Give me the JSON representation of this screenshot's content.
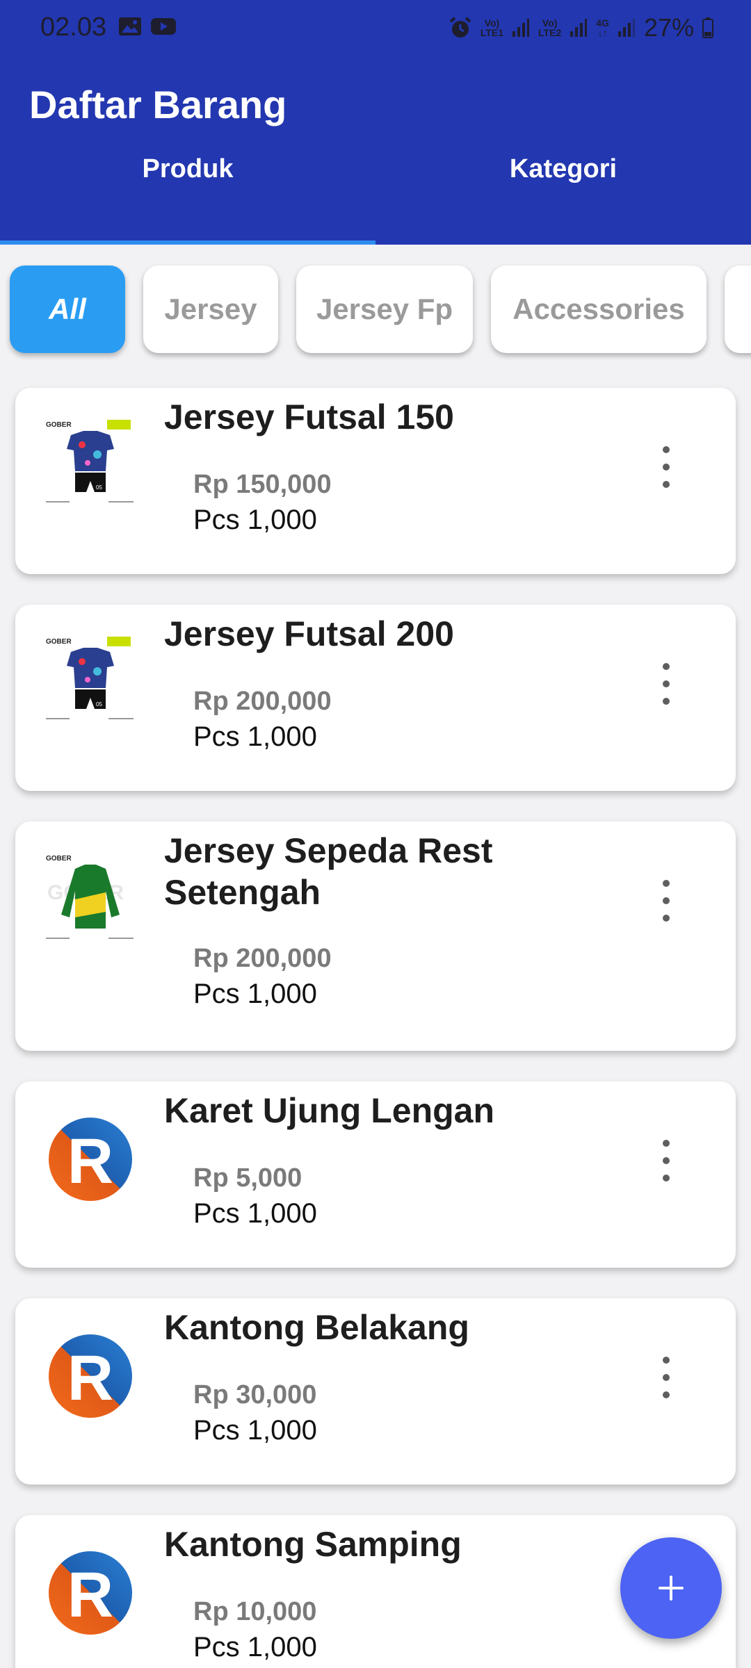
{
  "status_bar": {
    "time": "02.03",
    "sim1": "LTE1",
    "sim2": "LTE2",
    "network": "4G",
    "battery": "27%"
  },
  "app": {
    "title": "Daftar Barang",
    "tabs": [
      {
        "label": "Produk",
        "active": true
      },
      {
        "label": "Kategori",
        "active": false
      }
    ]
  },
  "chips": [
    {
      "label": "All",
      "active": true
    },
    {
      "label": "Jersey",
      "active": false
    },
    {
      "label": "Jersey Fp",
      "active": false
    },
    {
      "label": "Accessories",
      "active": false
    }
  ],
  "products": [
    {
      "name": "Jersey Futsal 150",
      "price": "Rp 150,000",
      "qty": "Pcs 1,000",
      "image": "jersey-futsal-image"
    },
    {
      "name": "Jersey Futsal 200",
      "price": "Rp 200,000",
      "qty": "Pcs 1,000",
      "image": "jersey-futsal-image"
    },
    {
      "name": "Jersey Sepeda Rest Setengah",
      "price": "Rp 200,000",
      "qty": "Pcs 1,000",
      "image": "cycling-jersey-image"
    },
    {
      "name": "Karet Ujung Lengan",
      "price": "Rp 5,000",
      "qty": "Pcs 1,000",
      "image": "r-logo"
    },
    {
      "name": "Kantong Belakang",
      "price": "Rp 30,000",
      "qty": "Pcs 1,000",
      "image": "r-logo"
    },
    {
      "name": "Kantong Samping",
      "price": "Rp 10,000",
      "qty": "Pcs 1,000",
      "image": "r-logo"
    }
  ],
  "fab": {
    "icon": "plus-icon"
  },
  "colors": {
    "header": "#2337b0",
    "tab_indicator": "#2f8df0",
    "chip_active": "#2a9df3",
    "fab": "#4c63f3"
  }
}
